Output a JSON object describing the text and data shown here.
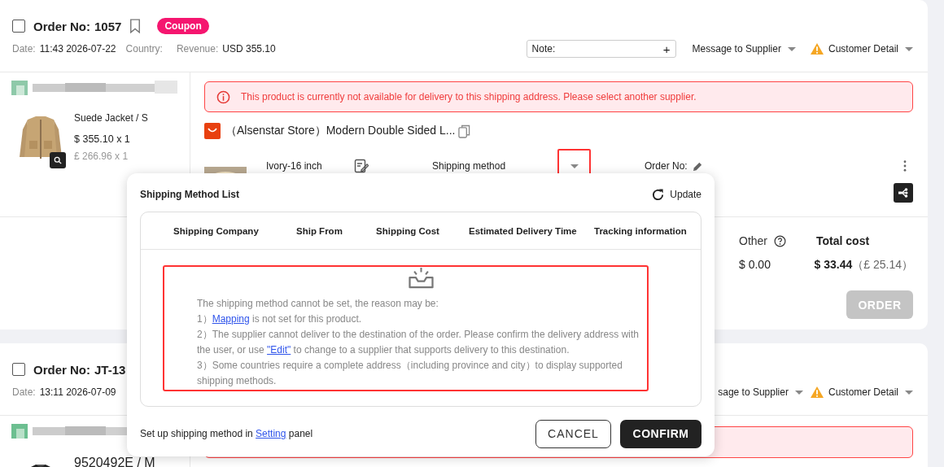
{
  "orders": [
    {
      "checked": false,
      "order_label": "Order No:",
      "order_no": "1057",
      "badge": "Coupon",
      "date_label": "Date:",
      "date": "11:43 2026-07-22",
      "country_label": "Country:",
      "revenue_label": "Revenue:",
      "revenue": "USD 355.10",
      "note_label": "Note:",
      "note_add": "+",
      "message": "Message to Supplier",
      "customer": "Customer Detail",
      "product": {
        "title": "Suede Jacket / S",
        "price": "$ 355.10 x 1",
        "price_local": "£ 266.96 x 1"
      },
      "alert": "This product is currently not available for delivery to this shipping address. Please select another supplier.",
      "supplier": "（Alsenstar Store）Modern Double Sided L...",
      "variant": "Ivory-16 inch",
      "shipping_label": "Shipping method",
      "supplier_order_label": "Order No:",
      "other_label": "Other",
      "other_value": "$ 0.00",
      "total_label": "Total cost",
      "total": "$ 33.44",
      "total_local": "（£ 25.14）",
      "order_button": {
        "label": "ORDER",
        "disabled": true
      }
    },
    {
      "checked": false,
      "order_label": "Order No:",
      "order_no": "JT-13",
      "date_label": "Date:",
      "date": "13:11 2026-07-09",
      "message": "sage to Supplier",
      "customer": "Customer Detail",
      "product": {
        "title": "9520492E / M"
      }
    }
  ],
  "shipping_dialog": {
    "title": "Shipping Method List",
    "update": "Update",
    "columns": [
      "Shipping Company",
      "Ship From",
      "Shipping Cost",
      "Estimated Delivery Time",
      "Tracking information"
    ],
    "empty_heading": "The shipping method cannot be set, the reason may be:",
    "reasons": [
      [
        {
          "text": "1）"
        },
        {
          "text": "Mapping",
          "link": true
        },
        {
          "text": " is not set for this product."
        }
      ],
      [
        {
          "text": "2）The supplier cannot deliver to the destination of the order. Please confirm the delivery address with the user, or use "
        },
        {
          "text": "\"Edit\"",
          "link": true
        },
        {
          "text": " to change to a supplier that supports delivery to this destination."
        }
      ],
      [
        {
          "text": "3）Some countries require a complete address（including province and city）to display supported shipping methods."
        }
      ]
    ],
    "footer": [
      {
        "text": "Set up shipping method in "
      },
      {
        "text": "Setting",
        "link": true
      },
      {
        "text": " panel"
      }
    ],
    "cancel": "CANCEL",
    "confirm": "CONFIRM"
  }
}
